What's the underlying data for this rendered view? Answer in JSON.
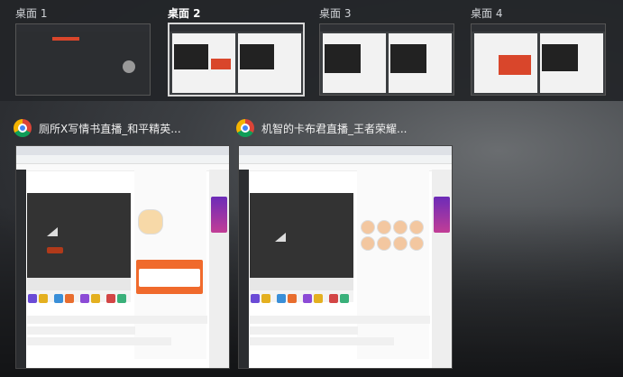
{
  "desktops": [
    {
      "label": "桌面 1",
      "active": false
    },
    {
      "label": "桌面 2",
      "active": true
    },
    {
      "label": "桌面 3",
      "active": false
    },
    {
      "label": "桌面 4",
      "active": false
    }
  ],
  "windows": [
    {
      "title": "厕所X写情书直播_和平精英..."
    },
    {
      "title": "机智的卡布君直播_王者荣耀..."
    }
  ]
}
